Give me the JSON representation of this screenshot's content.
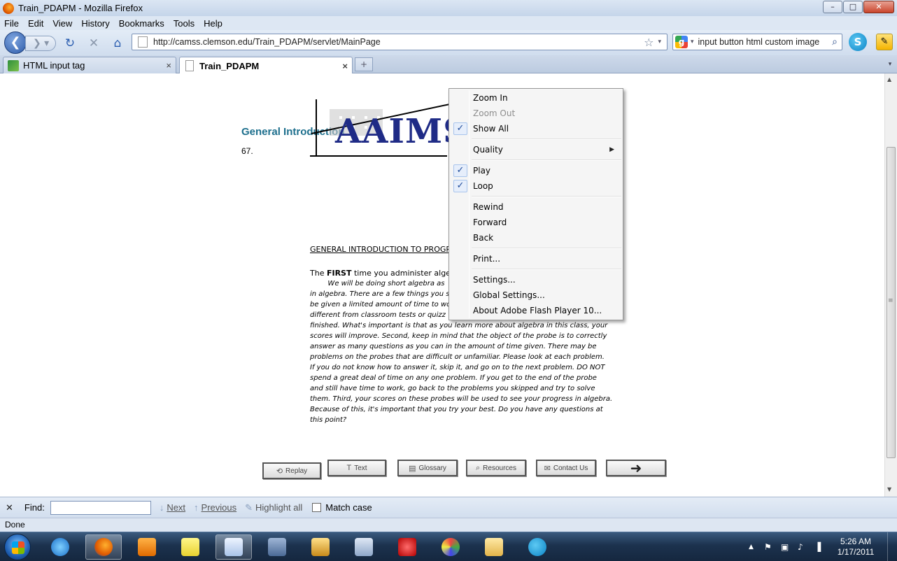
{
  "window": {
    "title": "Train_PDAPM - Mozilla Firefox",
    "minimize": "–",
    "maximize": "□",
    "close": "✕"
  },
  "menu": [
    "File",
    "Edit",
    "View",
    "History",
    "Bookmarks",
    "Tools",
    "Help"
  ],
  "nav": {
    "url": "http://camss.clemson.edu/Train_PDAPM/servlet/MainPage",
    "search_query": "input button html custom image",
    "back": "❮",
    "forward": "❯ ▾",
    "reload": "↻",
    "stop": "✕",
    "home": "⌂",
    "star": "☆",
    "dropdown": "▾",
    "search_engine_letter": "g",
    "search_icon_glyph": "⌕",
    "skype_glyph": "S",
    "pen_glyph": "✎"
  },
  "tabs": [
    {
      "label": "HTML input tag",
      "close": "×"
    },
    {
      "label": "Train_PDAPM",
      "close": "×"
    }
  ],
  "new_tab": "+",
  "tabs_dropdown": "▾",
  "page": {
    "title": "General Introduction",
    "number": "67."
  },
  "flash": {
    "logo": "AAIMS",
    "heading": "GENERAL INTRODUCTION TO PROGR",
    "first_line_prefix": "The ",
    "first_line_bold": "FIRST",
    "first_line_suffix": " time you administer algebra",
    "body_lines": [
      "        We will be doing short algebra as",
      "in algebra.  There are a few things you s",
      "be given a limited amount of time to wor",
      "different from classroom tests or quizz",
      "finished.  What's important is that as you learn more about algebra in this class, your",
      "scores will improve.  Second, keep in mind that the object of the probe is to correctly",
      "answer as many questions as you can in the amount of time given.  There may be",
      "problems on the probes that are difficult or unfamiliar.  Please look at each problem.",
      "If you do not know how to answer it, skip it, and go on to the next problem. DO NOT",
      "spend a great deal of time on any one problem.  If you get to the end of the probe",
      "and still have time to work, go back to the problems you skipped and try to solve",
      "them. Third, your scores on these probes will be used to see your progress in algebra.",
      "Because of this, it's important that you try your best.  Do you have any questions at",
      "this point?"
    ],
    "buttons": {
      "replay": "Replay",
      "text": "Text",
      "glossary": "Glossary",
      "resources": "Resources",
      "contact": "Contact Us"
    },
    "button_icons": {
      "replay": "⟲",
      "text": "T",
      "glossary": "▤",
      "resources": "⌕",
      "contact": "✉",
      "next": "➜"
    }
  },
  "context_menu": {
    "zoom_in": "Zoom In",
    "zoom_out": "Zoom Out",
    "show_all": "Show All",
    "quality": "Quality",
    "play": "Play",
    "loop": "Loop",
    "rewind": "Rewind",
    "forward": "Forward",
    "back": "Back",
    "print": "Print...",
    "settings": "Settings...",
    "global_settings": "Global Settings...",
    "about": "About Adobe Flash Player 10...",
    "check_glyph": "✓",
    "submenu_glyph": "▶"
  },
  "findbar": {
    "close": "✕",
    "label": "Find:",
    "next": "Next",
    "previous": "Previous",
    "highlight": "Highlight all",
    "match_case": "Match case",
    "next_glyph": "↓",
    "prev_glyph": "↑",
    "highlight_glyph": "✎"
  },
  "status": "Done",
  "scrollbar": {
    "up": "▲",
    "down": "▼",
    "grip": "≡"
  },
  "clock": {
    "time": "5:26 AM",
    "date": "1/17/2011"
  },
  "tray": {
    "show_hidden": "▲",
    "flag": "⚑",
    "network": "▣",
    "volume": "♪",
    "signal": "▐"
  },
  "colors": {
    "title_text": "#1d6f8d",
    "logo": "#1f2b86"
  }
}
